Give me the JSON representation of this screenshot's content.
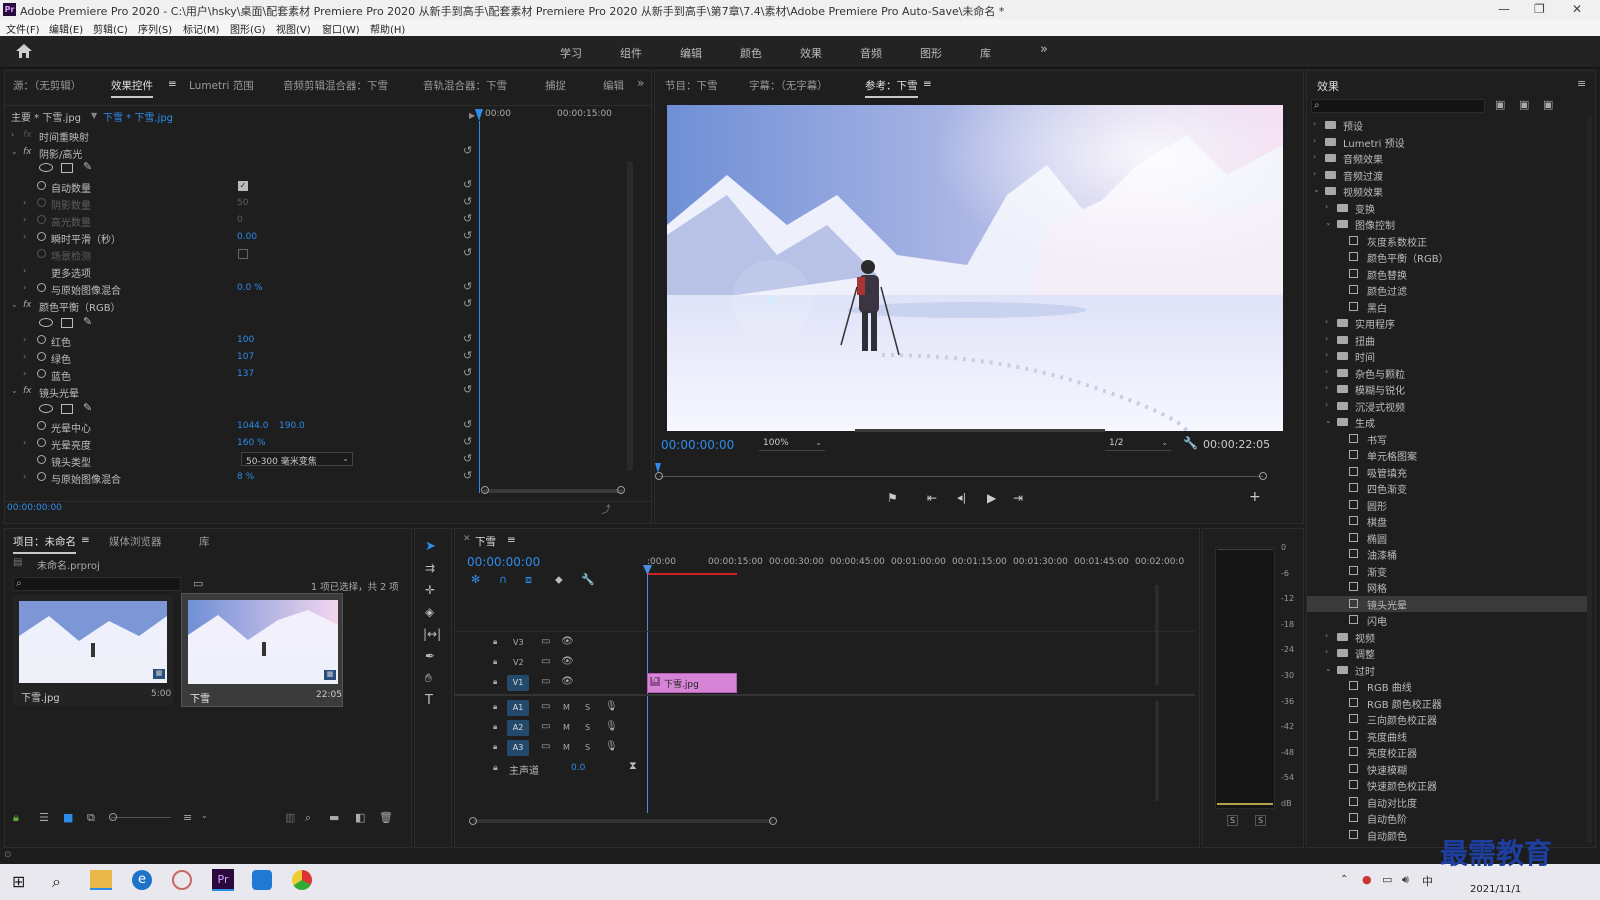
{
  "window": {
    "title": "Adobe Premiere Pro 2020 - C:\\用户\\hsky\\桌面\\配套素材 Premiere Pro 2020 从新手到高手\\配套素材 Premiere Pro 2020 从新手到高手\\第7章\\7.4\\素材\\Adobe Premiere Pro Auto-Save\\未命名 *"
  },
  "menu": [
    "文件(F)",
    "编辑(E)",
    "剪辑(C)",
    "序列(S)",
    "标记(M)",
    "图形(G)",
    "视图(V)",
    "窗口(W)",
    "帮助(H)"
  ],
  "workspaces": [
    "学习",
    "组件",
    "编辑",
    "颜色",
    "效果",
    "音频",
    "图形",
    "库"
  ],
  "source_panel": {
    "tabs": [
      "源：（无剪辑）",
      "效果控件",
      "Lumetri 范围",
      "音频剪辑混合器：下雪",
      "音轨混合器：下雪",
      "捕捉",
      "编辑"
    ],
    "clip_path": "主要 * 下雪.jpg",
    "sequence_clip": "下雪 * 下雪.jpg",
    "ruler": [
      "00:00",
      "00:00:15:00"
    ],
    "rows": {
      "time_remap": "时间重映射",
      "shadow_highlight": "阴影/高光",
      "auto_amount": "自动数量",
      "shadow_amount": "阴影数量",
      "shadow_amount_val": "50",
      "highlight_amount": "高光数量",
      "highlight_amount_val": "0",
      "temporal_smooth": "瞬时平滑（秒）",
      "temporal_smooth_val": "0.00",
      "scene_detect": "场景检测",
      "more_options": "更多选项",
      "blend1": "与原始图像混合",
      "blend1_val": "0.0 %",
      "color_balance": "颜色平衡（RGB）",
      "red": "红色",
      "red_val": "100",
      "green": "绿色",
      "green_val": "107",
      "blue": "蓝色",
      "blue_val": "137",
      "lens_flare": "镜头光晕",
      "flare_center": "光晕中心",
      "flare_x": "1044.0",
      "flare_y": "190.0",
      "flare_brightness": "光晕亮度",
      "flare_brightness_val": "160 %",
      "lens_type": "镜头类型",
      "lens_type_val": "50-300 毫米变焦",
      "blend2": "与原始图像混合",
      "blend2_val": "8 %"
    },
    "timecode": "00:00:00:00"
  },
  "program_panel": {
    "tabs": [
      "节目：下雪",
      "字幕：（无字幕）",
      "参考：下雪"
    ],
    "timecode": "00:00:00:00",
    "zoom": "100%",
    "quality": "1/2",
    "duration": "00:00:22:05"
  },
  "project_panel": {
    "tabs": [
      "项目：未命名",
      "媒体浏览器",
      "库"
    ],
    "project_file": "未命名.prproj",
    "selection": "1 项已选择，共 2 项",
    "items": [
      {
        "name": "下雪.jpg",
        "duration": "5:00"
      },
      {
        "name": "下雪",
        "duration": "22:05"
      }
    ]
  },
  "timeline": {
    "tab": "下雪",
    "timecode": "00:00:00:00",
    "ruler": [
      ":00:00",
      "00:00:15:00",
      "00:00:30:00",
      "00:00:45:00",
      "00:01:00:00",
      "00:01:15:00",
      "00:01:30:00",
      "00:01:45:00",
      "00:02:00:0"
    ],
    "tracks_video": [
      "V3",
      "V2",
      "V1"
    ],
    "tracks_audio": [
      "A1",
      "A2",
      "A3"
    ],
    "master": "主声道",
    "master_val": "0.0",
    "clip_label": "下雪.jpg",
    "track_m": "M",
    "track_s": "S"
  },
  "audio_meter": {
    "ticks": [
      "0",
      "-6",
      "-12",
      "-18",
      "-24",
      "-30",
      "-36",
      "-42",
      "-48",
      "-54",
      "dB"
    ],
    "solo": "S"
  },
  "effects_panel": {
    "title": "效果",
    "tree": [
      {
        "label": "预设",
        "level": 0,
        "type": "folder"
      },
      {
        "label": "Lumetri 预设",
        "level": 0,
        "type": "folder"
      },
      {
        "label": "音频效果",
        "level": 0,
        "type": "folder"
      },
      {
        "label": "音频过渡",
        "level": 0,
        "type": "folder"
      },
      {
        "label": "视频效果",
        "level": 0,
        "type": "folder-open"
      },
      {
        "label": "变换",
        "level": 1,
        "type": "folder"
      },
      {
        "label": "图像控制",
        "level": 1,
        "type": "folder-open"
      },
      {
        "label": "灰度系数校正",
        "level": 2,
        "type": "fx"
      },
      {
        "label": "颜色平衡（RGB）",
        "level": 2,
        "type": "fx"
      },
      {
        "label": "颜色替换",
        "level": 2,
        "type": "fx"
      },
      {
        "label": "颜色过滤",
        "level": 2,
        "type": "fx"
      },
      {
        "label": "黑白",
        "level": 2,
        "type": "fx"
      },
      {
        "label": "实用程序",
        "level": 1,
        "type": "folder"
      },
      {
        "label": "扭曲",
        "level": 1,
        "type": "folder"
      },
      {
        "label": "时间",
        "level": 1,
        "type": "folder"
      },
      {
        "label": "杂色与颗粒",
        "level": 1,
        "type": "folder"
      },
      {
        "label": "模糊与锐化",
        "level": 1,
        "type": "folder"
      },
      {
        "label": "沉浸式视频",
        "level": 1,
        "type": "folder"
      },
      {
        "label": "生成",
        "level": 1,
        "type": "folder-open"
      },
      {
        "label": "书写",
        "level": 2,
        "type": "fx"
      },
      {
        "label": "单元格图案",
        "level": 2,
        "type": "fx"
      },
      {
        "label": "吸管填充",
        "level": 2,
        "type": "fx"
      },
      {
        "label": "四色渐变",
        "level": 2,
        "type": "fx"
      },
      {
        "label": "圆形",
        "level": 2,
        "type": "fx"
      },
      {
        "label": "棋盘",
        "level": 2,
        "type": "fx"
      },
      {
        "label": "椭圆",
        "level": 2,
        "type": "fx"
      },
      {
        "label": "油漆桶",
        "level": 2,
        "type": "fx"
      },
      {
        "label": "渐变",
        "level": 2,
        "type": "fx"
      },
      {
        "label": "网格",
        "level": 2,
        "type": "fx"
      },
      {
        "label": "镜头光晕",
        "level": 2,
        "type": "fx",
        "selected": true
      },
      {
        "label": "闪电",
        "level": 2,
        "type": "fx"
      },
      {
        "label": "视频",
        "level": 1,
        "type": "folder"
      },
      {
        "label": "调整",
        "level": 1,
        "type": "folder"
      },
      {
        "label": "过时",
        "level": 1,
        "type": "folder-open"
      },
      {
        "label": "RGB 曲线",
        "level": 2,
        "type": "fx"
      },
      {
        "label": "RGB 颜色校正器",
        "level": 2,
        "type": "fx"
      },
      {
        "label": "三向颜色校正器",
        "level": 2,
        "type": "fx"
      },
      {
        "label": "亮度曲线",
        "level": 2,
        "type": "fx"
      },
      {
        "label": "亮度校正器",
        "level": 2,
        "type": "fx"
      },
      {
        "label": "快速模糊",
        "level": 2,
        "type": "fx"
      },
      {
        "label": "快速颜色校正器",
        "level": 2,
        "type": "fx"
      },
      {
        "label": "自动对比度",
        "level": 2,
        "type": "fx"
      },
      {
        "label": "自动色阶",
        "level": 2,
        "type": "fx"
      },
      {
        "label": "自动颜色",
        "level": 2,
        "type": "fx"
      }
    ]
  },
  "taskbar": {
    "date": "2021/11/1",
    "lang": "中"
  },
  "watermark": "最需教育",
  "colors": {
    "accent": "#2d8ceb",
    "clip": "#d685d6",
    "playhead": "#4a8ee0"
  }
}
